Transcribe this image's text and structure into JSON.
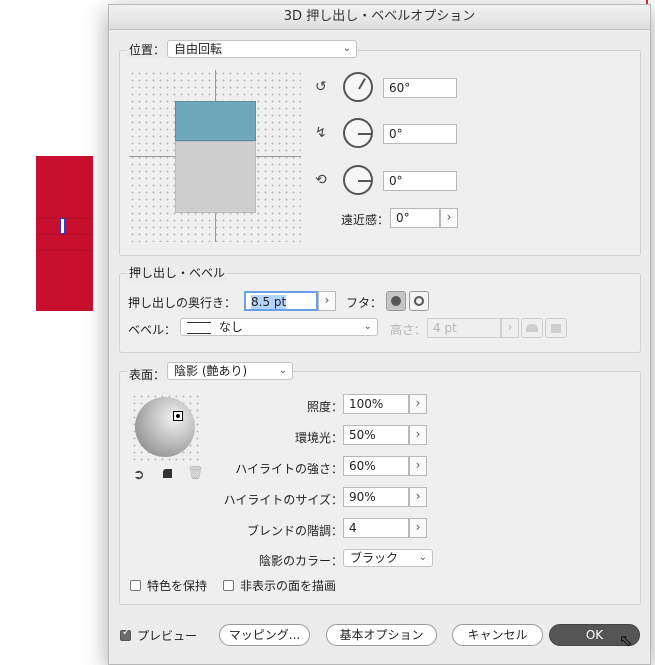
{
  "dialog_title": "3D 押し出し・ベベルオプション",
  "position": {
    "label": "位置：",
    "preset": "自由回転",
    "x_rotation": "60°",
    "y_rotation": "0°",
    "z_rotation": "0°",
    "perspective_label": "遠近感：",
    "perspective": "0°"
  },
  "extrude": {
    "section_label": "押し出し・ベベル",
    "depth_label": "押し出しの奥行き：",
    "depth": "8.5 pt",
    "cap_label": "フタ：",
    "bevel_label": "ベベル：",
    "bevel": "なし",
    "height_label": "高さ：",
    "height": "4 pt"
  },
  "surface": {
    "label": "表面：",
    "type": "陰影 (艶あり)",
    "light_intensity_label": "照度：",
    "light_intensity": "100%",
    "ambient_label": "環境光：",
    "ambient": "50%",
    "highlight_intensity_label": "ハイライトの強さ：",
    "highlight_intensity": "60%",
    "highlight_size_label": "ハイライトのサイズ：",
    "highlight_size": "90%",
    "blend_steps_label": "ブレンドの階調：",
    "blend_steps": "4",
    "shading_color_label": "陰影のカラー：",
    "shading_color": "ブラック",
    "preserve_spot_label": "特色を保持",
    "draw_hidden_label": "非表示の面を描画"
  },
  "footer": {
    "preview_label": "プレビュー",
    "preview_checked": true,
    "mapping_button": "マッピング...",
    "basic_options_button": "基本オプション",
    "cancel_button": "キャンセル",
    "ok_button": "OK"
  },
  "colors": {
    "cube_top": "#6fa8ba",
    "cube_front": "#cfcfcf",
    "object_red": "#c8102e",
    "ok_button": "#555555"
  }
}
